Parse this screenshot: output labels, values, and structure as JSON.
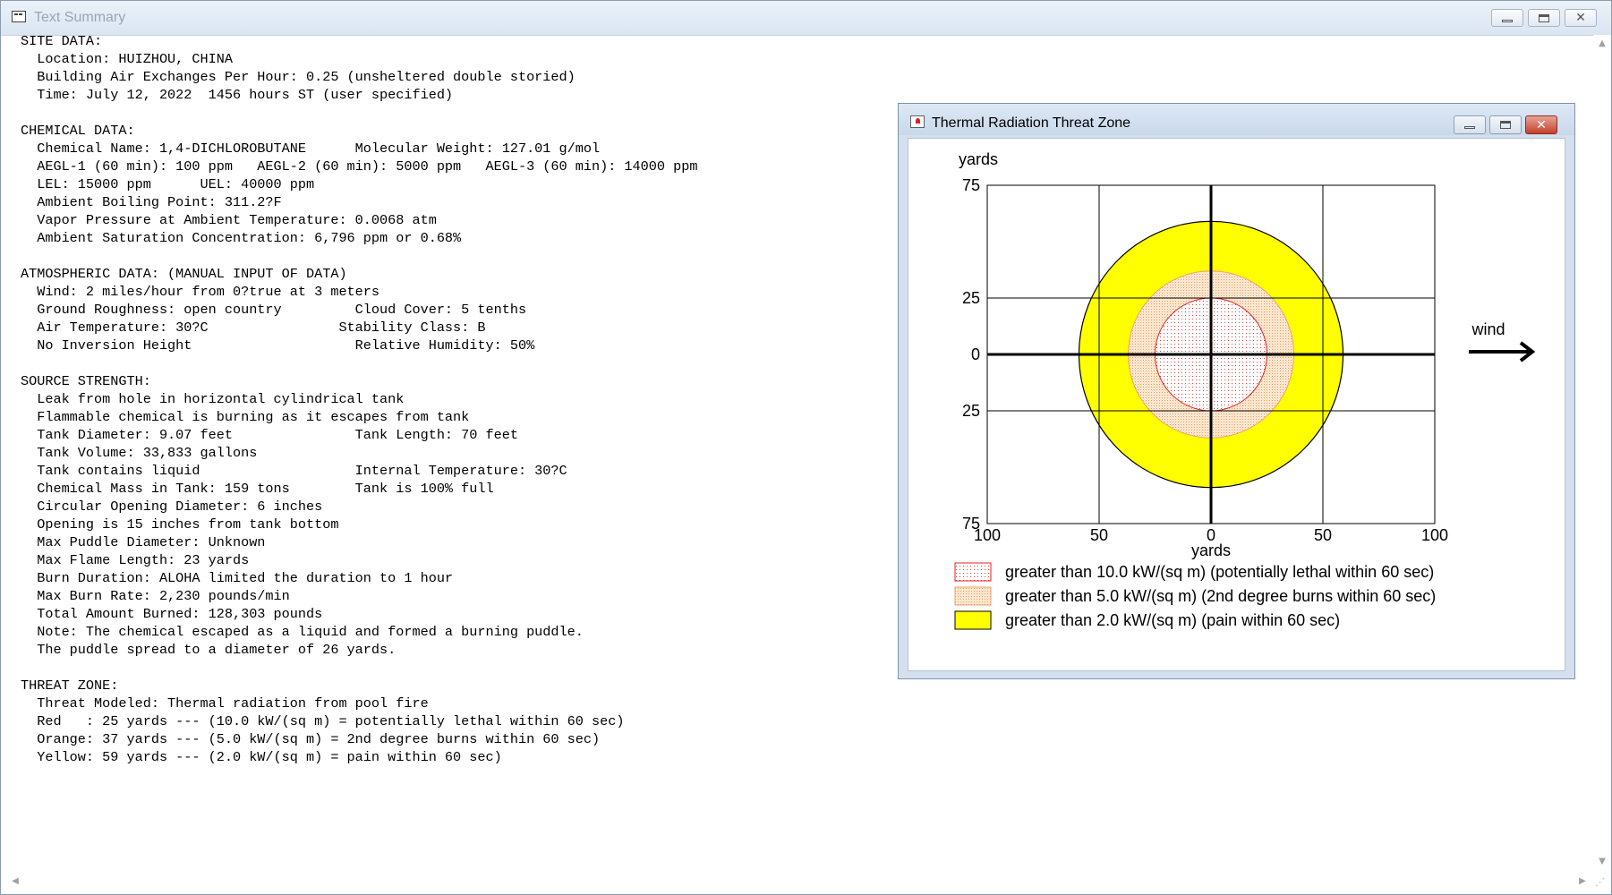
{
  "main_window": {
    "title": "Text Summary",
    "lines": [
      "SITE DATA:",
      "  Location: HUIZHOU, CHINA",
      "  Building Air Exchanges Per Hour: 0.25 (unsheltered double storied)",
      "  Time: July 12, 2022  1456 hours ST (user specified)",
      "",
      "CHEMICAL DATA:",
      "  Chemical Name: 1,4-DICHLOROBUTANE      Molecular Weight: 127.01 g/mol",
      "  AEGL-1 (60 min): 100 ppm   AEGL-2 (60 min): 5000 ppm   AEGL-3 (60 min): 14000 ppm",
      "  LEL: 15000 ppm      UEL: 40000 ppm",
      "  Ambient Boiling Point: 311.2?F",
      "  Vapor Pressure at Ambient Temperature: 0.0068 atm",
      "  Ambient Saturation Concentration: 6,796 ppm or 0.68%",
      "",
      "ATMOSPHERIC DATA: (MANUAL INPUT OF DATA)",
      "  Wind: 2 miles/hour from 0?true at 3 meters",
      "  Ground Roughness: open country         Cloud Cover: 5 tenths",
      "  Air Temperature: 30?C                Stability Class: B",
      "  No Inversion Height                    Relative Humidity: 50%",
      "",
      "SOURCE STRENGTH:",
      "  Leak from hole in horizontal cylindrical tank",
      "  Flammable chemical is burning as it escapes from tank",
      "  Tank Diameter: 9.07 feet               Tank Length: 70 feet",
      "  Tank Volume: 33,833 gallons",
      "  Tank contains liquid                   Internal Temperature: 30?C",
      "  Chemical Mass in Tank: 159 tons        Tank is 100% full",
      "  Circular Opening Diameter: 6 inches",
      "  Opening is 15 inches from tank bottom",
      "  Max Puddle Diameter: Unknown",
      "  Max Flame Length: 23 yards",
      "  Burn Duration: ALOHA limited the duration to 1 hour",
      "  Max Burn Rate: 2,230 pounds/min",
      "  Total Amount Burned: 128,303 pounds",
      "  Note: The chemical escaped as a liquid and formed a burning puddle.",
      "  The puddle spread to a diameter of 26 yards.",
      "",
      "THREAT ZONE:",
      "  Threat Modeled: Thermal radiation from pool fire",
      "  Red   : 25 yards --- (10.0 kW/(sq m) = potentially lethal within 60 sec)",
      "  Orange: 37 yards --- (5.0 kW/(sq m) = 2nd degree burns within 60 sec)",
      "  Yellow: 59 yards --- (2.0 kW/(sq m) = pain within 60 sec)"
    ]
  },
  "threat_window": {
    "title": "Thermal Radiation Threat Zone",
    "wind_label": "wind",
    "y_axis_label": "yards",
    "x_axis_label": "yards",
    "x_ticks": [
      "100",
      "50",
      "0",
      "50",
      "100"
    ],
    "y_ticks": [
      "75",
      "25",
      "0",
      "25",
      "75"
    ],
    "zones": [
      {
        "name": "red",
        "radius_yards": 25,
        "color": "#ffe6e6",
        "stroke": "#e02020",
        "legend": "greater than 10.0 kW/(sq m) (potentially lethal within 60 sec)"
      },
      {
        "name": "orange",
        "radius_yards": 37,
        "color": "#fcdcc0",
        "stroke": "#f0a070",
        "legend": "greater than 5.0 kW/(sq m) (2nd degree burns within 60 sec)"
      },
      {
        "name": "yellow",
        "radius_yards": 59,
        "color": "#ffff00",
        "stroke": "#000000",
        "legend": "greater than 2.0 kW/(sq m) (pain within 60 sec)"
      }
    ],
    "x_range_yards": [
      -100,
      100
    ],
    "y_range_yards": [
      -75,
      75
    ]
  }
}
